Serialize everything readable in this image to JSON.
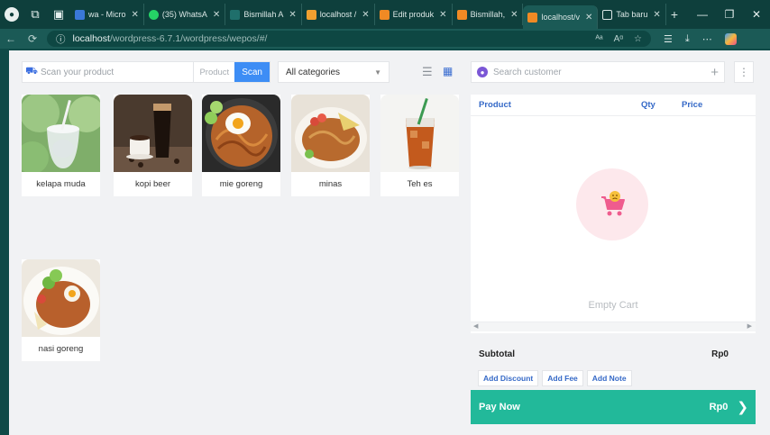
{
  "browser": {
    "tabs": [
      {
        "label": "wa - Micro",
        "color": "#3a78d8"
      },
      {
        "label": "(35) WhatsA",
        "color": "#25d366"
      },
      {
        "label": "Bismillah A",
        "color": "#1f6f6b"
      },
      {
        "label": "localhost /",
        "color": "#f0a030"
      },
      {
        "label": "Edit produk",
        "color": "#f08a24"
      },
      {
        "label": "Bismillah,",
        "color": "#f08a24"
      },
      {
        "label": "localhost/v",
        "color": "#f08a24"
      },
      {
        "label": "Tab baru",
        "color": "#dbe7e6"
      }
    ],
    "new_tab": "+",
    "url_host": "localhost",
    "url_path": "/wordpress-6.7.1/wordpress/wepos/#/"
  },
  "toolbar": {
    "scan_placeholder": "Scan your product",
    "product_label": "Product",
    "scan_button": "Scan",
    "category_selected": "All categories"
  },
  "products": [
    {
      "name": "kelapa muda"
    },
    {
      "name": "kopi beer"
    },
    {
      "name": "mie goreng"
    },
    {
      "name": "minas"
    },
    {
      "name": "Teh es"
    },
    {
      "name": "nasi goreng"
    }
  ],
  "customer": {
    "search_placeholder": "Search customer"
  },
  "cart": {
    "col_product": "Product",
    "col_qty": "Qty",
    "col_price": "Price",
    "empty_text": "Empty Cart",
    "subtotal_label": "Subtotal",
    "subtotal_value": "Rp0",
    "add_discount": "Add Discount",
    "add_fee": "Add Fee",
    "add_note": "Add Note",
    "pay_label": "Pay Now",
    "pay_value": "Rp0"
  },
  "colors": {
    "accent_blue": "#3d8df5",
    "pay_green": "#22b99a",
    "browser_bg": "#0e3f3c"
  }
}
